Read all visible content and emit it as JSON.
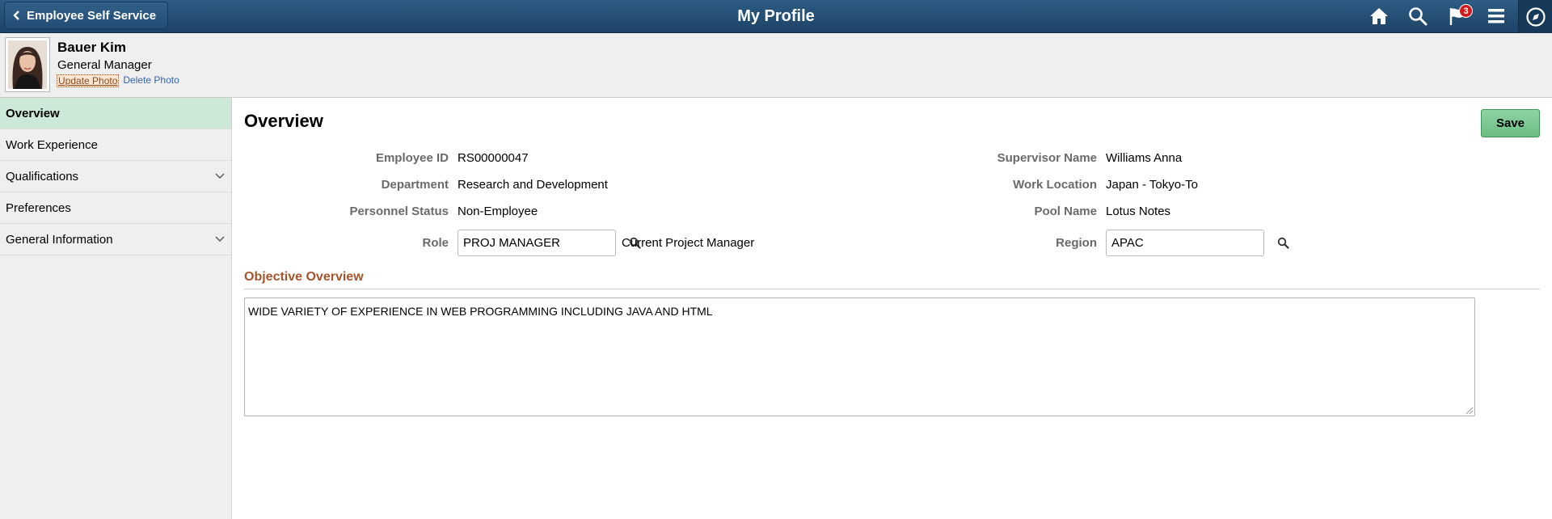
{
  "banner": {
    "back_label": "Employee Self Service",
    "title": "My Profile",
    "notification_count": "3",
    "icons": [
      "home-icon",
      "search-icon",
      "flag-icon",
      "menu-icon",
      "navbar-icon"
    ]
  },
  "profile": {
    "name": "Bauer Kim",
    "job_title": "General Manager",
    "update_photo": "Update Photo",
    "delete_photo": "Delete Photo"
  },
  "sidebar": {
    "items": [
      {
        "label": "Overview",
        "active": true,
        "expandable": false
      },
      {
        "label": "Work Experience",
        "active": false,
        "expandable": false
      },
      {
        "label": "Qualifications",
        "active": false,
        "expandable": true
      },
      {
        "label": "Preferences",
        "active": false,
        "expandable": false
      },
      {
        "label": "General Information",
        "active": false,
        "expandable": true
      }
    ]
  },
  "main": {
    "heading": "Overview",
    "save_label": "Save",
    "fields": {
      "employee_id": {
        "label": "Employee ID",
        "value": "RS00000047"
      },
      "department": {
        "label": "Department",
        "value": "Research and Development"
      },
      "personnel_status": {
        "label": "Personnel Status",
        "value": "Non-Employee"
      },
      "role": {
        "label": "Role",
        "value": "PROJ MANAGER",
        "description": "Current Project Manager"
      },
      "supervisor_name": {
        "label": "Supervisor Name",
        "value": "Williams Anna"
      },
      "work_location": {
        "label": "Work Location",
        "value": "Japan - Tokyo-To"
      },
      "pool_name": {
        "label": "Pool Name",
        "value": "Lotus Notes"
      },
      "region": {
        "label": "Region",
        "value": "APAC"
      }
    },
    "objective": {
      "heading": "Objective Overview",
      "text": "WIDE VARIETY OF EXPERIENCE IN WEB PROGRAMMING INCLUDING JAVA AND HTML"
    }
  },
  "colors": {
    "banner": "#1d4366",
    "active_nav": "#cce9d8",
    "save_button": "#7cc894",
    "section_heading": "#a7542b",
    "badge": "#d01b1b"
  }
}
